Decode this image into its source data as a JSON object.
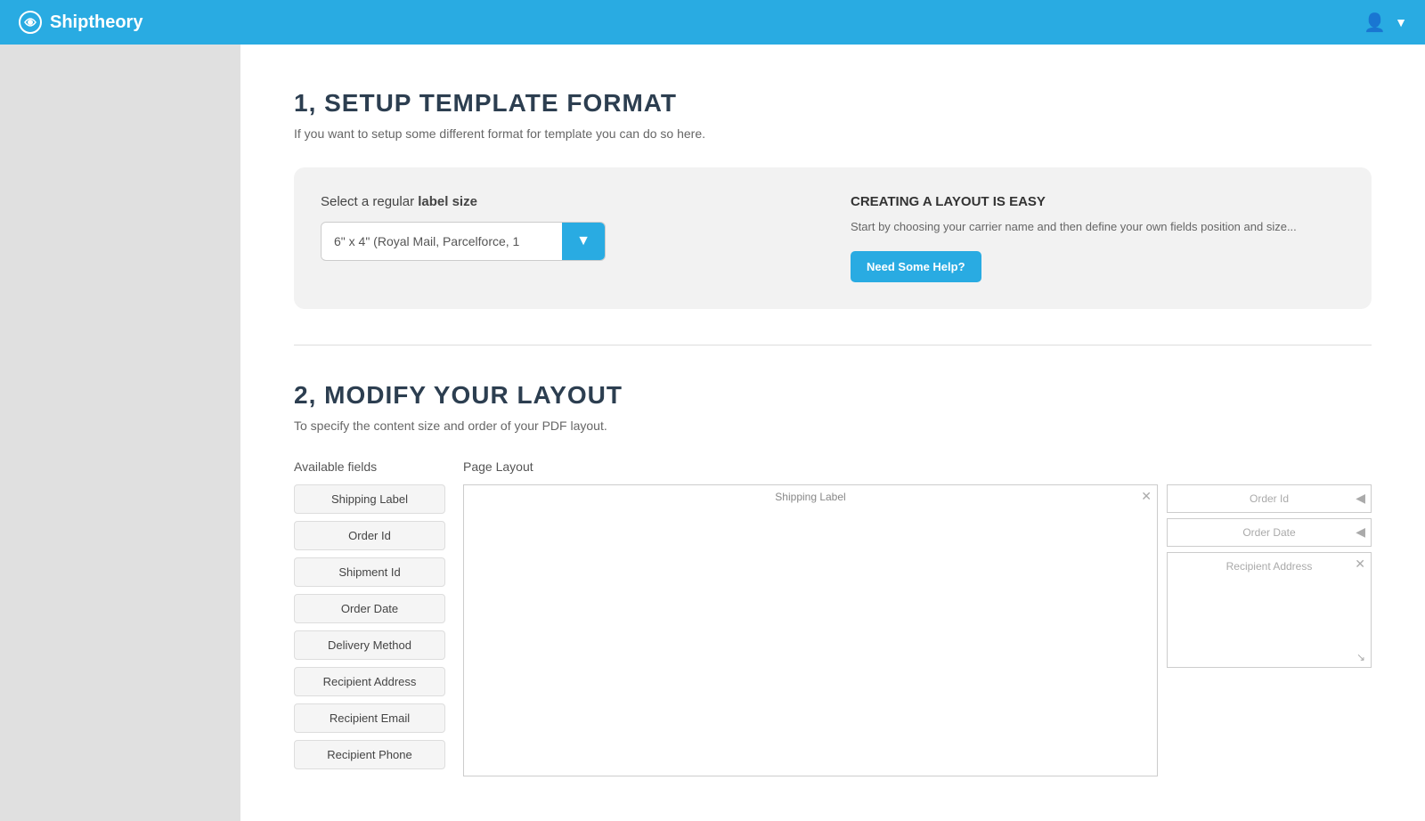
{
  "header": {
    "logo_text": "Shiptheory",
    "user_icon": "👤",
    "chevron_icon": "▼"
  },
  "section1": {
    "title": "1, SETUP TEMPLATE FORMAT",
    "subtitle": "If you want to setup some different format for template you can do so here.",
    "label_prefix": "Select a regular ",
    "label_bold": "label size",
    "select_value": "6\" x 4\" (Royal Mail, Parcelforce, 1",
    "help_title": "CREATING A LAYOUT IS EASY",
    "help_text": "Start by choosing your carrier name and then define your own fields position and size...",
    "help_btn": "Need Some Help?"
  },
  "section2": {
    "title": "2, MODIFY YOUR LAYOUT",
    "subtitle": "To specify the content size and order of your PDF layout.",
    "col_available": "Available fields",
    "col_layout": "Page Layout",
    "available_fields": [
      "Shipping Label",
      "Order Id",
      "Shipment Id",
      "Order Date",
      "Delivery Method",
      "Recipient Address",
      "Recipient Email",
      "Recipient Phone"
    ],
    "layout_fields": {
      "shipping_label": "Shipping Label",
      "small_boxes": [
        "Order Id",
        "Order Date"
      ],
      "big_box": "Recipient Address"
    }
  }
}
